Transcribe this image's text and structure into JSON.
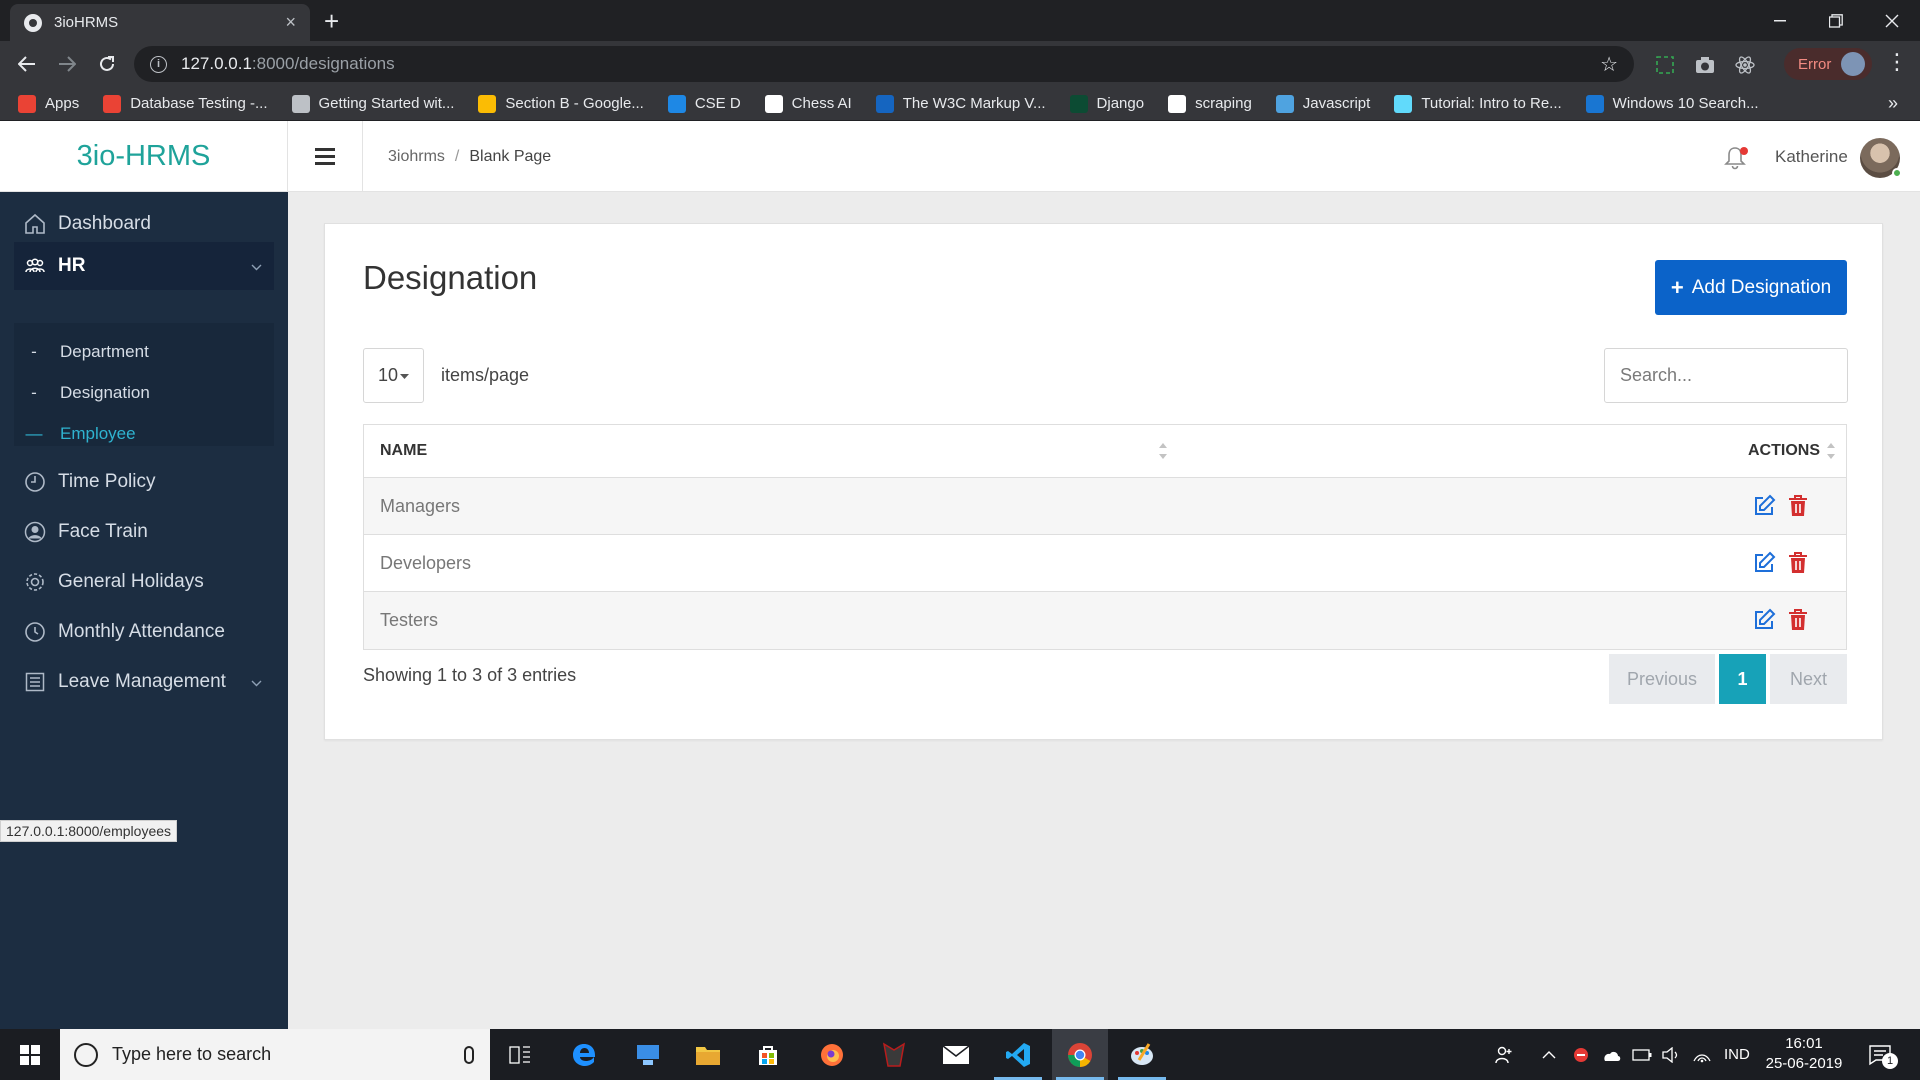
{
  "browser": {
    "tab_title": "3ioHRMS",
    "tab_close": "×",
    "new_tab": "+",
    "url_host": "127.0.0.1",
    "url_path": ":8000/designations",
    "extension_status": "Error",
    "bookmarks": [
      {
        "label": "Apps",
        "icon": "apps-grid-icon",
        "color": "#ea4335"
      },
      {
        "label": "Database Testing -...",
        "icon": "database-icon",
        "color": "#ea4335"
      },
      {
        "label": "Getting Started wit...",
        "icon": "chrome-icon",
        "color": "#bdc1c6"
      },
      {
        "label": "Section B - Google...",
        "icon": "google-drive-icon",
        "color": "#fbbc04"
      },
      {
        "label": "CSE D",
        "icon": "classroom-icon",
        "color": "#1e88e5"
      },
      {
        "label": "Chess AI",
        "icon": "chess-icon",
        "color": "#ffffff"
      },
      {
        "label": "The W3C Markup V...",
        "icon": "w3c-icon",
        "color": "#1565c0"
      },
      {
        "label": "Django",
        "icon": "django-icon",
        "color": "#0c4b33"
      },
      {
        "label": "scraping",
        "icon": "github-icon",
        "color": "#ffffff"
      },
      {
        "label": "Javascript",
        "icon": "javascript-icon",
        "color": "#4fa3e0"
      },
      {
        "label": "Tutorial: Intro to Re...",
        "icon": "react-icon",
        "color": "#61dafb"
      },
      {
        "label": "Windows 10 Search...",
        "icon": "windows-search-icon",
        "color": "#1976d2"
      }
    ],
    "more_bookmarks": "»",
    "status_url": "127.0.0.1:8000/employees"
  },
  "app": {
    "brand": "3io-HRMS",
    "breadcrumb": [
      "3iohrms",
      "Blank Page"
    ],
    "breadcrumb_sep": "/",
    "user_name": "Katherine",
    "accent_color": "#1fa39a"
  },
  "sidebar": {
    "items": [
      {
        "label": "Dashboard",
        "icon": "home-icon"
      },
      {
        "label": "HR",
        "icon": "team-icon",
        "expanded": true
      },
      {
        "label": "Time Policy",
        "icon": "clock-icon"
      },
      {
        "label": "Face Train",
        "icon": "user-circle-icon"
      },
      {
        "label": "General Holidays",
        "icon": "gear-icon"
      },
      {
        "label": "Monthly Attendance",
        "icon": "calendar-clock-icon"
      },
      {
        "label": "Leave Management",
        "icon": "list-icon",
        "has_submenu": true
      }
    ],
    "hr_submenu": [
      {
        "label": "Department",
        "marker": "-"
      },
      {
        "label": "Designation",
        "marker": "-"
      },
      {
        "label": "Employee",
        "marker": "—",
        "active": true
      }
    ]
  },
  "page": {
    "title": "Designation",
    "add_button": "Add Designation",
    "page_size": "10",
    "page_size_label": "items/page",
    "search_placeholder": "Search...",
    "table": {
      "columns": [
        "NAME",
        "ACTIONS"
      ],
      "rows": [
        {
          "name": "Managers"
        },
        {
          "name": "Developers"
        },
        {
          "name": "Testers"
        }
      ]
    },
    "showing": "Showing 1 to 3 of 3 entries",
    "pagination": {
      "previous": "Previous",
      "current": "1",
      "next": "Next"
    }
  },
  "taskbar": {
    "search_placeholder": "Type here to search",
    "language": "IND",
    "time": "16:01",
    "date": "25-06-2019",
    "notification_count": "1"
  }
}
